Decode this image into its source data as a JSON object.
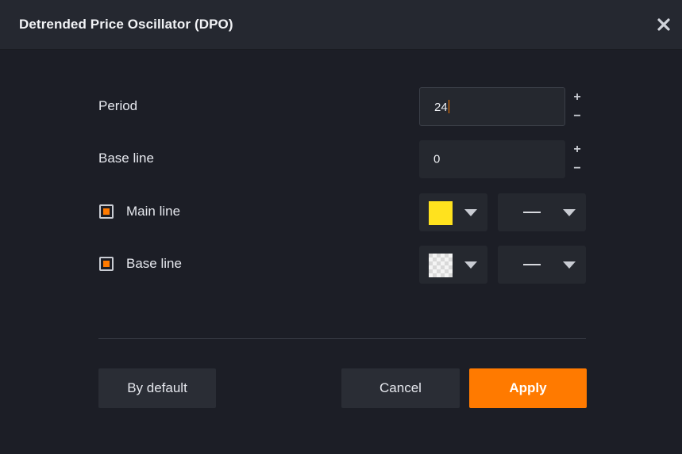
{
  "dialog": {
    "title": "Detrended Price Oscillator (DPO)",
    "close_icon": "close-icon"
  },
  "fields": {
    "period": {
      "label": "Period",
      "value": "24"
    },
    "base_value": {
      "label": "Base line",
      "value": "0"
    },
    "stepper": {
      "plus": "+",
      "minus": "−"
    }
  },
  "lines": [
    {
      "label": "Main line",
      "checked": true,
      "color": "#ffe21e",
      "style": "solid"
    },
    {
      "label": "Base line",
      "checked": true,
      "color": "transparent",
      "style": "solid"
    }
  ],
  "colors": {
    "accent": "#ff7a00",
    "background": "#1c1e26",
    "panel": "#25282f"
  },
  "buttons": {
    "default_label": "By default",
    "cancel_label": "Cancel",
    "apply_label": "Apply"
  }
}
